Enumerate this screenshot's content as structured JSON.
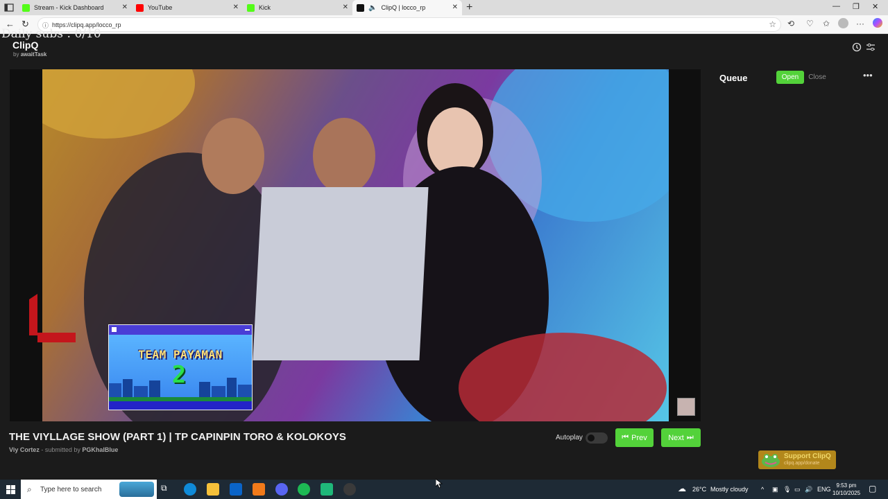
{
  "browser": {
    "tabs": [
      {
        "label": "Stream - Kick Dashboard",
        "favicon_color": "#53fc18"
      },
      {
        "label": "YouTube",
        "favicon_color": "#ff0000"
      },
      {
        "label": "Kick",
        "favicon_color": "#53fc18"
      },
      {
        "label": "ClipQ | locco_rp",
        "favicon_color": "#111111",
        "active": true
      }
    ],
    "url": "https://clipq.app/locco_rp"
  },
  "overlay_text": "Daily subs : 0/10",
  "app": {
    "title": "ClipQ",
    "byline_prefix": "by",
    "byline_author": "awaitTask"
  },
  "video": {
    "inset_title": "TEAM PAYAMAN",
    "inset_number": "2"
  },
  "clip": {
    "title": "THE VIYLLAGE SHOW (PART 1) | TP CAPINPIN TORO & KOLOKOYS",
    "creator": "Viy Cortez",
    "submitted_label": "- submitted by",
    "submitter": "PGKhalBlue"
  },
  "controls": {
    "autoplay_label": "Autoplay",
    "autoplay_on": false,
    "prev_label": "Prev",
    "next_label": "Next",
    "accent_color": "#53d23a"
  },
  "queue": {
    "title": "Queue",
    "open_label": "Open",
    "close_label": "Close"
  },
  "support": {
    "title": "Support ClipQ",
    "subtitle": "clipq.app/donate"
  },
  "taskbar": {
    "search_placeholder": "Type here to search",
    "weather_temp": "26°C",
    "weather_text": "Mostly cloudy",
    "language": "ENG",
    "time": "9:53 pm",
    "date": "10/10/2025"
  }
}
